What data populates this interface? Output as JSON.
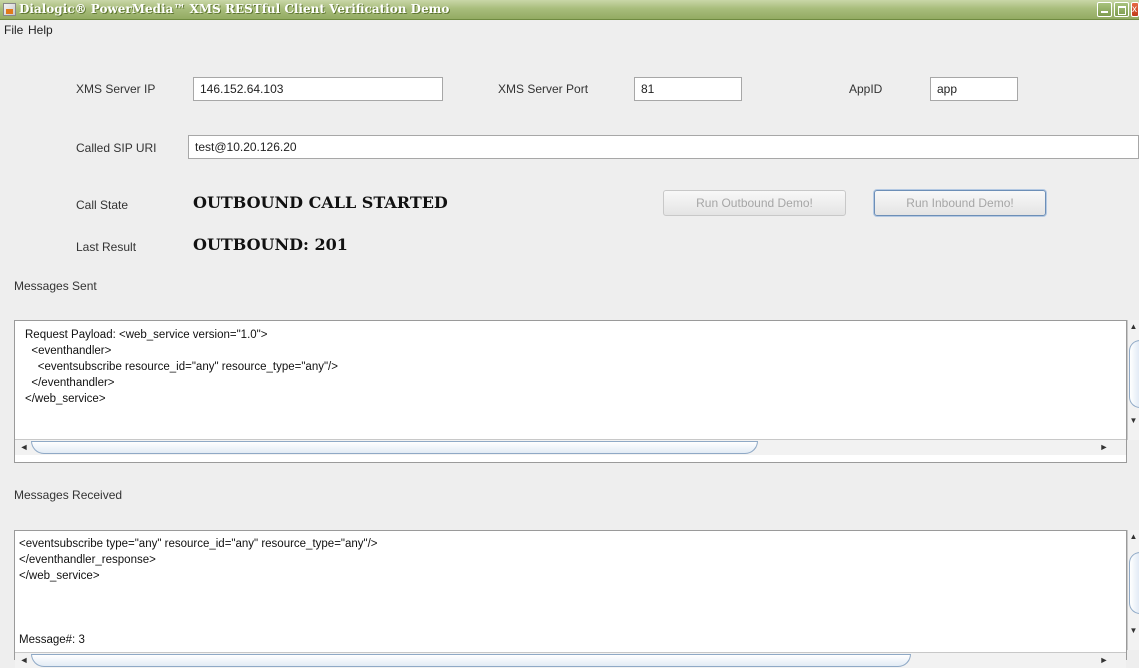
{
  "window": {
    "title": "Dialogic® PowerMedia™ XMS RESTful Client Verification Demo",
    "close_glyph": "x"
  },
  "menu": [
    "File",
    "Help"
  ],
  "form": {
    "server_ip_label": "XMS Server IP",
    "server_ip_value": "146.152.64.103",
    "server_port_label": "XMS Server Port",
    "server_port_value": "81",
    "appid_label": "AppID",
    "appid_value": "app",
    "sip_uri_label": "Called SIP URI",
    "sip_uri_value": "test@10.20.126.20",
    "call_state_label": "Call State",
    "call_state_value": "OUTBOUND CALL STARTED",
    "last_result_label": "Last Result",
    "last_result_value": "OUTBOUND: 201"
  },
  "buttons": {
    "outbound": "Run Outbound Demo!",
    "inbound": "Run Inbound Demo!"
  },
  "sent": {
    "label": "Messages Sent",
    "lines": [
      "Request Payload: <web_service version=\"1.0\">",
      "  <eventhandler>",
      "    <eventsubscribe resource_id=\"any\" resource_type=\"any\"/>",
      "  </eventhandler>",
      "</web_service>"
    ]
  },
  "received": {
    "label": "Messages Received",
    "lines": [
      "<eventsubscribe type=\"any\" resource_id=\"any\" resource_type=\"any\"/>",
      "</eventhandler_response>",
      "</web_service>"
    ],
    "footer": "Message#: 3"
  },
  "scroll_glyphs": {
    "left": "◄",
    "right": "►",
    "up": "▲",
    "down": "▼"
  }
}
